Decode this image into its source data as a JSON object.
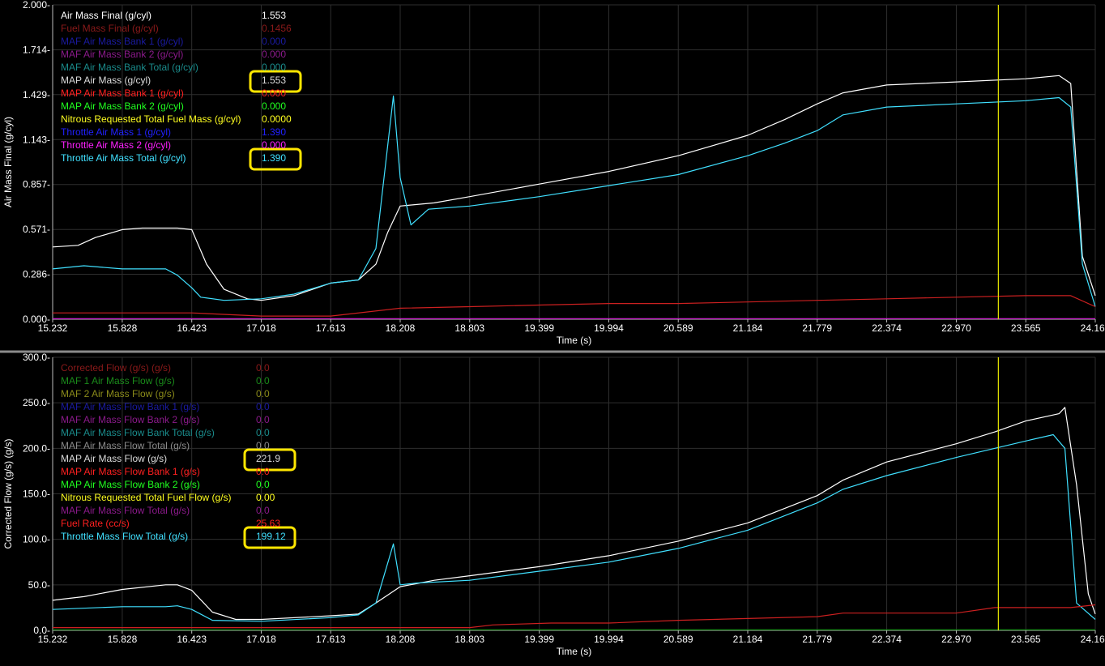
{
  "colors": {
    "background": "#000000",
    "grid": "#2e2e2e",
    "axis_text": "#ffffff",
    "divider": "#8a8a8a",
    "cursor": "#e8e800",
    "highlight": "#ffe600"
  },
  "chart_data": [
    {
      "type": "line",
      "ylabel": "Air Mass Final (g/cyl)",
      "xlabel": "Time (s)",
      "xlim": [
        15.232,
        24.16
      ],
      "ylim": [
        0,
        2.0
      ],
      "xticks": [
        "15.232",
        "15.828",
        "16.423",
        "17.018",
        "17.613",
        "18.208",
        "18.803",
        "19.399",
        "19.994",
        "20.589",
        "21.184",
        "21.779",
        "22.374",
        "22.970",
        "23.565",
        "24.160"
      ],
      "yticks": [
        "0.000",
        "0.286",
        "0.571",
        "0.857",
        "1.143",
        "1.429",
        "1.714",
        "2.000"
      ],
      "cursor_x": 23.33,
      "grid": true,
      "legend": [
        {
          "label": "Air Mass Final (g/cyl)",
          "value": "1.553",
          "color": "#ffffff"
        },
        {
          "label": "Fuel Mass Final (g/cyl)",
          "value": "0.1456",
          "color": "#8b1a1a"
        },
        {
          "label": "MAF Air Mass Bank 1 (g/cyl)",
          "value": "0.000",
          "color": "#1a1aa0"
        },
        {
          "label": "MAF Air Mass Bank 2  (g/cyl)",
          "value": "0.000",
          "color": "#8b1a8b"
        },
        {
          "label": "MAF Air Mass Bank Total (g/cyl)",
          "value": "0.000",
          "color": "#1a8b8b"
        },
        {
          "label": "MAP Air Mass (g/cyl)",
          "value": "1.553",
          "color": "#dcdcdc",
          "highlight": true
        },
        {
          "label": "MAP Air Mass Bank 1 (g/cyl)",
          "value": "0.000",
          "color": "#ff2020"
        },
        {
          "label": "MAP Air Mass Bank 2 (g/cyl)",
          "value": "0.000",
          "color": "#20ff20"
        },
        {
          "label": "Nitrous Requested Total Fuel Mass (g/cyl)",
          "value": "0.0000",
          "color": "#ffff20"
        },
        {
          "label": "Throttle Air Mass 1 (g/cyl)",
          "value": "1.390",
          "color": "#2020ff"
        },
        {
          "label": "Throttle Air Mass 2 (g/cyl)",
          "value": "0.000",
          "color": "#ff20ff"
        },
        {
          "label": "Throttle Air Mass Total (g/cyl)",
          "value": "1.390",
          "color": "#40e0ff",
          "highlight": true
        }
      ],
      "series": [
        {
          "color": "#ffffff",
          "x": [
            15.232,
            15.45,
            15.6,
            15.828,
            16.0,
            16.3,
            16.423,
            16.55,
            16.7,
            16.9,
            17.018,
            17.3,
            17.613,
            17.85,
            18.0,
            18.1,
            18.208,
            18.5,
            18.803,
            19.399,
            19.994,
            20.589,
            21.184,
            21.5,
            21.779,
            22.0,
            22.374,
            22.97,
            23.565,
            23.85,
            23.95,
            24.05,
            24.16
          ],
          "y": [
            0.46,
            0.47,
            0.52,
            0.57,
            0.58,
            0.58,
            0.57,
            0.35,
            0.19,
            0.13,
            0.12,
            0.15,
            0.23,
            0.25,
            0.35,
            0.55,
            0.72,
            0.74,
            0.78,
            0.86,
            0.94,
            1.04,
            1.17,
            1.27,
            1.37,
            1.44,
            1.49,
            1.51,
            1.53,
            1.55,
            1.5,
            0.4,
            0.15
          ]
        },
        {
          "color": "#40e0ff",
          "x": [
            15.232,
            15.5,
            15.828,
            16.2,
            16.3,
            16.423,
            16.5,
            16.7,
            17.018,
            17.3,
            17.613,
            17.85,
            18.0,
            18.15,
            18.208,
            18.3,
            18.45,
            18.803,
            19.399,
            19.994,
            20.589,
            21.184,
            21.5,
            21.779,
            22.0,
            22.374,
            22.97,
            23.565,
            23.85,
            23.95,
            24.05,
            24.16
          ],
          "y": [
            0.32,
            0.34,
            0.32,
            0.32,
            0.28,
            0.2,
            0.14,
            0.12,
            0.13,
            0.16,
            0.23,
            0.25,
            0.45,
            1.42,
            0.9,
            0.6,
            0.7,
            0.72,
            0.78,
            0.85,
            0.92,
            1.04,
            1.12,
            1.2,
            1.3,
            1.35,
            1.37,
            1.39,
            1.41,
            1.35,
            0.35,
            0.08
          ]
        },
        {
          "color": "#cc2020",
          "x": [
            15.232,
            16.423,
            17.018,
            17.613,
            18.208,
            18.803,
            19.399,
            19.994,
            20.589,
            21.184,
            21.779,
            22.374,
            22.97,
            23.565,
            23.95,
            24.16
          ],
          "y": [
            0.04,
            0.04,
            0.02,
            0.02,
            0.07,
            0.08,
            0.09,
            0.1,
            0.1,
            0.11,
            0.12,
            0.13,
            0.14,
            0.15,
            0.15,
            0.08
          ]
        },
        {
          "color": "#cc20cc",
          "x": [
            15.232,
            24.16
          ],
          "y": [
            0.003,
            0.003
          ]
        }
      ]
    },
    {
      "type": "line",
      "ylabel": "Corrected Flow (g/s) (g/s)",
      "xlabel": "Time (s)",
      "xlim": [
        15.232,
        24.16
      ],
      "ylim": [
        0,
        300
      ],
      "xticks": [
        "15.232",
        "15.828",
        "16.423",
        "17.018",
        "17.613",
        "18.208",
        "18.803",
        "19.399",
        "19.994",
        "20.589",
        "21.184",
        "21.779",
        "22.374",
        "22.970",
        "23.565",
        "24.160"
      ],
      "yticks": [
        "0.0",
        "50.0",
        "100.0",
        "150.0",
        "200.0",
        "250.0",
        "300.0"
      ],
      "cursor_x": 23.33,
      "grid": true,
      "legend": [
        {
          "label": "Corrected Flow (g/s) (g/s)",
          "value": "0.0",
          "color": "#8b1a1a"
        },
        {
          "label": "MAF 1 Air Mass Flow (g/s)",
          "value": "0.0",
          "color": "#1a8b1a"
        },
        {
          "label": "MAF 2 Air Mass Flow (g/s)",
          "value": "0.0",
          "color": "#8b8b1a"
        },
        {
          "label": "MAF Air Mass Flow Bank 1  (g/s)",
          "value": "0.0",
          "color": "#1a1aa0"
        },
        {
          "label": "MAF Air Mass Flow Bank 2  (g/s)",
          "value": "0.0",
          "color": "#8b1a8b"
        },
        {
          "label": "MAF Air Mass Flow Bank Total  (g/s)",
          "value": "0.0",
          "color": "#1a8b8b"
        },
        {
          "label": "MAF Air Mass Flow Total  (g/s)",
          "value": "0.0",
          "color": "#8b8b8b"
        },
        {
          "label": "MAP Air Mass Flow (g/s)",
          "value": "221.9",
          "color": "#dcdcdc",
          "highlight": true
        },
        {
          "label": "MAP Air Mass Flow Bank 1 (g/s)",
          "value": "0.0",
          "color": "#ff2020"
        },
        {
          "label": "MAP Air Mass Flow Bank 2 (g/s)",
          "value": "0.0",
          "color": "#20ff20"
        },
        {
          "label": "Nitrous Requested Total Fuel Flow  (g/s)",
          "value": "0.00",
          "color": "#ffff20"
        },
        {
          "label": "MAF Air Mass Flow Total  (g/s)",
          "value": "0.0",
          "color": "#8b1a8b"
        },
        {
          "label": "Fuel Rate (cc/s)",
          "value": "25.63",
          "color": "#ff2020"
        },
        {
          "label": "Throttle Mass Flow Total (g/s)",
          "value": "199.12",
          "color": "#40e0ff",
          "highlight": true
        }
      ],
      "series": [
        {
          "color": "#ffffff",
          "x": [
            15.232,
            15.5,
            15.828,
            16.2,
            16.3,
            16.423,
            16.6,
            16.8,
            17.018,
            17.613,
            17.85,
            18.0,
            18.208,
            18.5,
            18.803,
            19.399,
            19.994,
            20.589,
            21.184,
            21.779,
            22.0,
            22.374,
            22.97,
            23.3,
            23.565,
            23.85,
            23.9,
            24.0,
            24.1,
            24.16
          ],
          "y": [
            33,
            37,
            45,
            50,
            50,
            44,
            20,
            12,
            12,
            16,
            18,
            30,
            48,
            55,
            60,
            70,
            82,
            98,
            118,
            148,
            165,
            185,
            205,
            218,
            230,
            238,
            245,
            160,
            40,
            18
          ]
        },
        {
          "color": "#40e0ff",
          "x": [
            15.232,
            15.828,
            16.2,
            16.3,
            16.423,
            16.6,
            17.018,
            17.613,
            17.85,
            18.0,
            18.15,
            18.208,
            18.35,
            18.803,
            19.399,
            19.994,
            20.589,
            21.184,
            21.779,
            22.0,
            22.374,
            22.97,
            23.565,
            23.8,
            23.9,
            24.0,
            24.16
          ],
          "y": [
            23,
            26,
            26,
            27,
            23,
            11,
            10,
            14,
            17,
            30,
            95,
            50,
            52,
            55,
            65,
            75,
            90,
            110,
            140,
            155,
            170,
            190,
            208,
            215,
            200,
            30,
            12
          ]
        },
        {
          "color": "#cc2020",
          "x": [
            15.232,
            16.423,
            17.018,
            17.613,
            18.208,
            18.803,
            19.0,
            19.5,
            19.994,
            20.589,
            21.184,
            21.779,
            22.0,
            22.374,
            22.97,
            23.3,
            23.565,
            23.95,
            24.16
          ],
          "y": [
            3,
            3,
            3,
            3,
            3,
            3,
            6,
            8,
            8,
            11,
            13,
            15,
            19,
            19,
            19,
            25,
            25,
            25,
            28
          ]
        },
        {
          "color": "#1a8b1a",
          "x": [
            15.232,
            24.16
          ],
          "y": [
            0.5,
            0.5
          ]
        }
      ]
    }
  ]
}
